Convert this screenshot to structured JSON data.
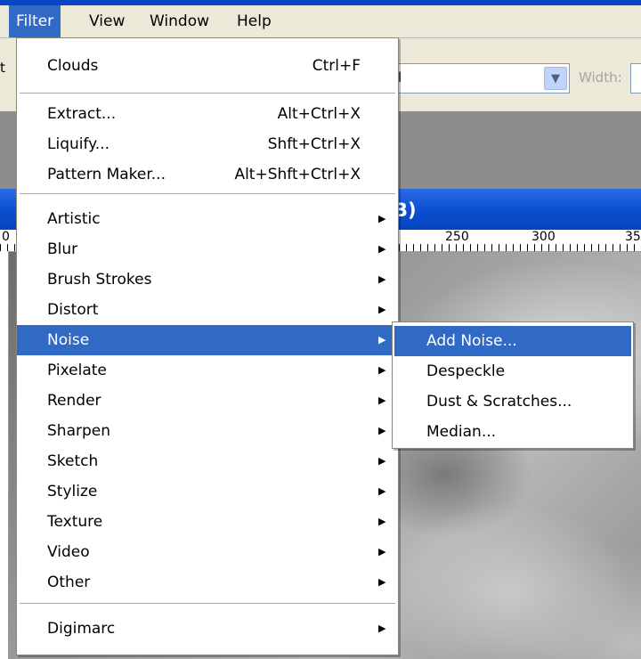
{
  "menubar": {
    "items": [
      {
        "label": "Filter",
        "active": true
      },
      {
        "label": "View",
        "active": false
      },
      {
        "label": "Window",
        "active": false
      },
      {
        "label": "Help",
        "active": false
      }
    ]
  },
  "options_bar": {
    "left_fragment": "t",
    "combo_value": "l",
    "combo_arrow_icon": "chevron-down-icon",
    "width_label": "Width:"
  },
  "document": {
    "title_fragment": "B)",
    "ruler_labels": [
      "0",
      "250",
      "300",
      "35"
    ]
  },
  "filter_menu": {
    "items": [
      {
        "label": "Clouds",
        "shortcut": "Ctrl+F",
        "submenu": false
      },
      {
        "label": "Extract...",
        "shortcut": "Alt+Ctrl+X",
        "submenu": false
      },
      {
        "label": "Liquify...",
        "shortcut": "Shft+Ctrl+X",
        "submenu": false
      },
      {
        "label": "Pattern Maker...",
        "shortcut": "Alt+Shft+Ctrl+X",
        "submenu": false
      },
      {
        "label": "Artistic",
        "shortcut": "",
        "submenu": true
      },
      {
        "label": "Blur",
        "shortcut": "",
        "submenu": true
      },
      {
        "label": "Brush Strokes",
        "shortcut": "",
        "submenu": true
      },
      {
        "label": "Distort",
        "shortcut": "",
        "submenu": true
      },
      {
        "label": "Noise",
        "shortcut": "",
        "submenu": true,
        "highlighted": true
      },
      {
        "label": "Pixelate",
        "shortcut": "",
        "submenu": true
      },
      {
        "label": "Render",
        "shortcut": "",
        "submenu": true
      },
      {
        "label": "Sharpen",
        "shortcut": "",
        "submenu": true
      },
      {
        "label": "Sketch",
        "shortcut": "",
        "submenu": true
      },
      {
        "label": "Stylize",
        "shortcut": "",
        "submenu": true
      },
      {
        "label": "Texture",
        "shortcut": "",
        "submenu": true
      },
      {
        "label": "Video",
        "shortcut": "",
        "submenu": true
      },
      {
        "label": "Other",
        "shortcut": "",
        "submenu": true
      },
      {
        "label": "Digimarc",
        "shortcut": "",
        "submenu": true
      }
    ],
    "submenu_arrow_icon": "triangle-right-icon"
  },
  "noise_submenu": {
    "items": [
      {
        "label": "Add Noise...",
        "highlighted": true
      },
      {
        "label": "Despeckle"
      },
      {
        "label": "Dust & Scratches..."
      },
      {
        "label": "Median..."
      }
    ]
  },
  "colors": {
    "highlight": "#316ac5",
    "menubar_bg": "#ece9d8",
    "title_bar": "#0a4fcf"
  }
}
